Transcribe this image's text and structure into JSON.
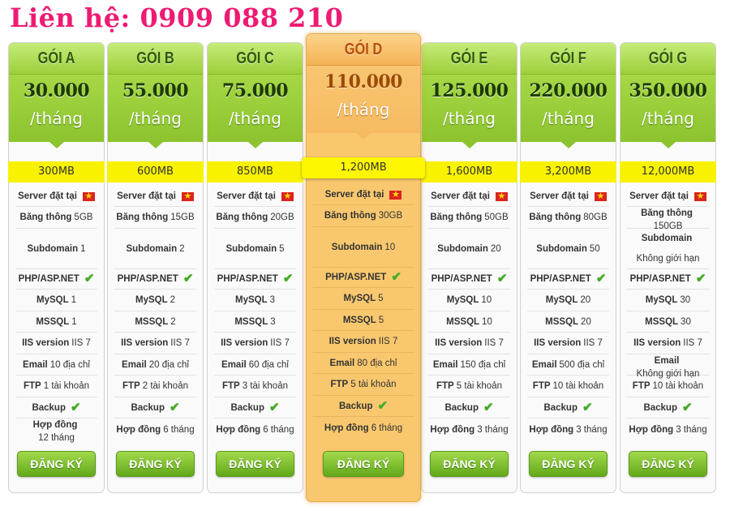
{
  "contact": "Liên hệ: 0909 088 210",
  "colors": {
    "contact": "#ee1b72",
    "header_green": "#a6d845",
    "featured_orange": "#f9c86e",
    "quota_yellow": "#f8f200",
    "button_green": "#62a91a"
  },
  "icons": {
    "flag": "vietnam-flag-icon",
    "check": "green-check-icon"
  },
  "plans": [
    {
      "name": "GÓI A",
      "price": "30.000",
      "period": "/tháng",
      "quota": "300MB",
      "featured": false,
      "server": "Server đặt tại",
      "bandwidth_label": "Băng thông",
      "bandwidth": "5GB",
      "subdomain_label": "Subdomain",
      "subdomain": "1",
      "php": "PHP/ASP.NET",
      "mysql_label": "MySQL",
      "mysql": "1",
      "mssql_label": "MSSQL",
      "mssql": "1",
      "iis_label": "IIS version",
      "iis": "IIS 7",
      "email_label": "Email",
      "email": "10 địa chỉ",
      "ftp_label": "FTP",
      "ftp": "1 tài khoản",
      "backup": "Backup",
      "contract_label": "Hợp đồng",
      "contract": "12 tháng",
      "button": "ĐĂNG KÝ"
    },
    {
      "name": "GÓI B",
      "price": "55.000",
      "period": "/tháng",
      "quota": "600MB",
      "featured": false,
      "server": "Server đặt tại",
      "bandwidth_label": "Băng thông",
      "bandwidth": "15GB",
      "subdomain_label": "Subdomain",
      "subdomain": "2",
      "php": "PHP/ASP.NET",
      "mysql_label": "MySQL",
      "mysql": "2",
      "mssql_label": "MSSQL",
      "mssql": "2",
      "iis_label": "IIS version",
      "iis": "IIS 7",
      "email_label": "Email",
      "email": "20 địa chỉ",
      "ftp_label": "FTP",
      "ftp": "2 tài khoản",
      "backup": "Backup",
      "contract_label": "Hợp đồng",
      "contract": "6 tháng",
      "button": "ĐĂNG KÝ"
    },
    {
      "name": "GÓI C",
      "price": "75.000",
      "period": "/tháng",
      "quota": "850MB",
      "featured": false,
      "server": "Server đặt tại",
      "bandwidth_label": "Băng thông",
      "bandwidth": "20GB",
      "subdomain_label": "Subdomain",
      "subdomain": "5",
      "php": "PHP/ASP.NET",
      "mysql_label": "MySQL",
      "mysql": "3",
      "mssql_label": "MSSQL",
      "mssql": "3",
      "iis_label": "IIS version",
      "iis": "IIS 7",
      "email_label": "Email",
      "email": "60 địa chỉ",
      "ftp_label": "FTP",
      "ftp": "3 tài khoản",
      "backup": "Backup",
      "contract_label": "Hợp đồng",
      "contract": "6 tháng",
      "button": "ĐĂNG KÝ"
    },
    {
      "name": "GÓI D",
      "price": "110.000",
      "period": "/tháng",
      "quota": "1,200MB",
      "featured": true,
      "server": "Server đặt tại",
      "bandwidth_label": "Băng thông",
      "bandwidth": "30GB",
      "subdomain_label": "Subdomain",
      "subdomain": "10",
      "php": "PHP/ASP.NET",
      "mysql_label": "MySQL",
      "mysql": "5",
      "mssql_label": "MSSQL",
      "mssql": "5",
      "iis_label": "IIS version",
      "iis": "IIS 7",
      "email_label": "Email",
      "email": "80 địa chỉ",
      "ftp_label": "FTP",
      "ftp": "5 tài khoản",
      "backup": "Backup",
      "contract_label": "Hợp đồng",
      "contract": "6 tháng",
      "button": "ĐĂNG KÝ"
    },
    {
      "name": "GÓI E",
      "price": "125.000",
      "period": "/tháng",
      "quota": "1,600MB",
      "featured": false,
      "server": "Server đặt tại",
      "bandwidth_label": "Băng thông",
      "bandwidth": "50GB",
      "subdomain_label": "Subdomain",
      "subdomain": "20",
      "php": "PHP/ASP.NET",
      "mysql_label": "MySQL",
      "mysql": "10",
      "mssql_label": "MSSQL",
      "mssql": "10",
      "iis_label": "IIS version",
      "iis": "IIS 7",
      "email_label": "Email",
      "email": "150 địa chỉ",
      "ftp_label": "FTP",
      "ftp": "5 tài khoản",
      "backup": "Backup",
      "contract_label": "Hợp đồng",
      "contract": "3 tháng",
      "button": "ĐĂNG KÝ"
    },
    {
      "name": "GÓI F",
      "price": "220.000",
      "period": "/tháng",
      "quota": "3,200MB",
      "featured": false,
      "server": "Server đặt tại",
      "bandwidth_label": "Băng thông",
      "bandwidth": "80GB",
      "subdomain_label": "Subdomain",
      "subdomain": "50",
      "php": "PHP/ASP.NET",
      "mysql_label": "MySQL",
      "mysql": "20",
      "mssql_label": "MSSQL",
      "mssql": "20",
      "iis_label": "IIS version",
      "iis": "IIS 7",
      "email_label": "Email",
      "email": "500 địa chỉ",
      "ftp_label": "FTP",
      "ftp": "10 tài khoản",
      "backup": "Backup",
      "contract_label": "Hợp đồng",
      "contract": "3 tháng",
      "button": "ĐĂNG KÝ"
    },
    {
      "name": "GÓI G",
      "price": "350.000",
      "period": "/tháng",
      "quota": "12,000MB",
      "featured": false,
      "server": "Server đặt tại",
      "bandwidth_label": "Băng thông",
      "bandwidth": "150GB",
      "subdomain_label": "Subdomain",
      "subdomain": "Không giới hạn",
      "php": "PHP/ASP.NET",
      "mysql_label": "MySQL",
      "mysql": "30",
      "mssql_label": "MSSQL",
      "mssql": "30",
      "iis_label": "IIS version",
      "iis": "IIS 7",
      "email_label": "Email",
      "email": "Không giới hạn",
      "ftp_label": "FTP",
      "ftp": "10 tài khoản",
      "backup": "Backup",
      "contract_label": "Hợp đồng",
      "contract": "3 tháng",
      "button": "ĐĂNG KÝ"
    }
  ]
}
